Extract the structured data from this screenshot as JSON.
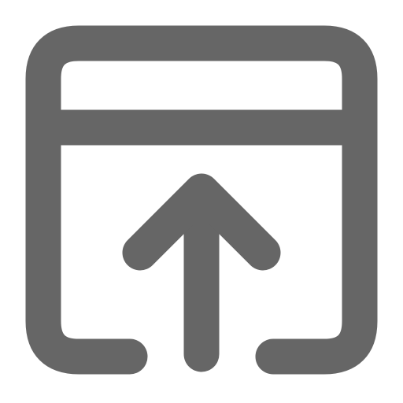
{
  "icon": {
    "name": "window-upload-icon",
    "color": "#666666",
    "background": "#ffffff"
  }
}
